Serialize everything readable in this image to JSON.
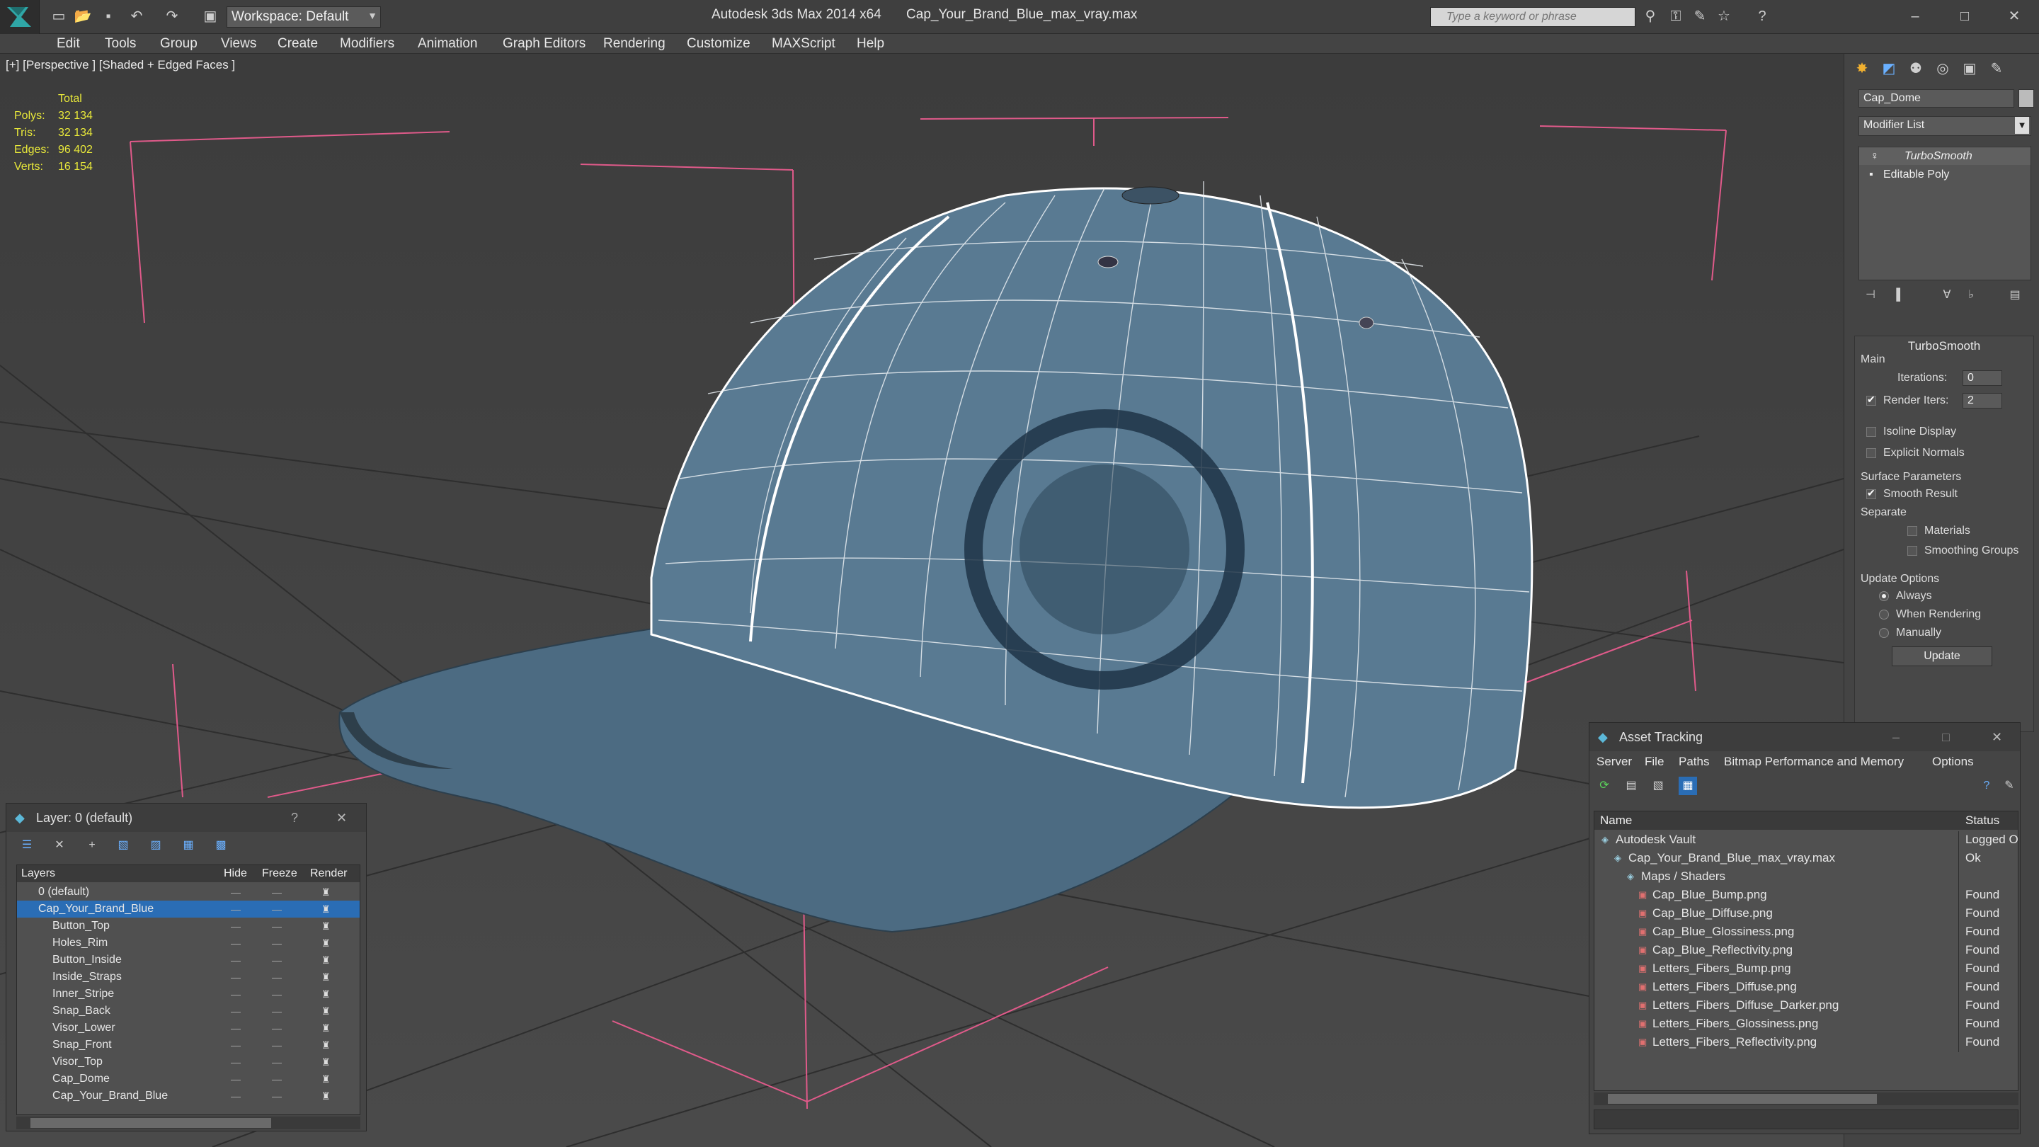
{
  "title": {
    "app": "Autodesk 3ds Max  2014 x64",
    "file": "Cap_Your_Brand_Blue_max_vray.max",
    "workspace": "Workspace: Default",
    "search_placeholder": "Type a keyword or phrase"
  },
  "menu": [
    "Edit",
    "Tools",
    "Group",
    "Views",
    "Create",
    "Modifiers",
    "Animation",
    "Graph Editors",
    "Rendering",
    "Customize",
    "MAXScript",
    "Help"
  ],
  "viewport": {
    "label": "[+] [Perspective ] [Shaded + Edged Faces ]",
    "stats": {
      "header": "Total",
      "rows": [
        {
          "label": "Polys:",
          "value": "32 134"
        },
        {
          "label": "Tris:",
          "value": "32 134"
        },
        {
          "label": "Edges:",
          "value": "96 402"
        },
        {
          "label": "Verts:",
          "value": "16 154"
        }
      ]
    }
  },
  "command_panel": {
    "object_name": "Cap_Dome",
    "modifier_list": "Modifier List",
    "stack": [
      "TurboSmooth",
      "Editable Poly"
    ],
    "rollout_title": "TurboSmooth",
    "main_label": "Main",
    "iterations_label": "Iterations:",
    "iterations_value": "0",
    "render_iters_label": "Render Iters:",
    "render_iters_value": "2",
    "isoline": "Isoline Display",
    "explicit_normals": "Explicit Normals",
    "surface_params": "Surface Parameters",
    "smooth_result": "Smooth Result",
    "separate": "Separate",
    "materials": "Materials",
    "smoothing_groups": "Smoothing Groups",
    "update_options": "Update Options",
    "always": "Always",
    "when_rendering": "When Rendering",
    "manually": "Manually",
    "update_button": "Update"
  },
  "layer_window": {
    "title": "Layer: 0 (default)",
    "help": "?",
    "columns": [
      "Layers",
      "Hide",
      "Freeze",
      "Render"
    ],
    "layers": [
      "0 (default)",
      "Cap_Your_Brand_Blue",
      "Button_Top",
      "Holes_Rim",
      "Button_Inside",
      "Inside_Straps",
      "Inner_Stripe",
      "Snap_Back",
      "Visor_Lower",
      "Snap_Front",
      "Visor_Top",
      "Cap_Dome",
      "Cap_Your_Brand_Blue"
    ]
  },
  "asset_window": {
    "title": "Asset Tracking",
    "menu": [
      "Server",
      "File",
      "Paths",
      "Bitmap Performance and Memory",
      "Options"
    ],
    "columns": [
      "Name",
      "Status"
    ],
    "rows": [
      {
        "name": "Autodesk Vault",
        "status": "Logged O"
      },
      {
        "name": "Cap_Your_Brand_Blue_max_vray.max",
        "status": "Ok"
      },
      {
        "name": "Maps / Shaders",
        "status": ""
      },
      {
        "name": "Cap_Blue_Bump.png",
        "status": "Found"
      },
      {
        "name": "Cap_Blue_Diffuse.png",
        "status": "Found"
      },
      {
        "name": "Cap_Blue_Glossiness.png",
        "status": "Found"
      },
      {
        "name": "Cap_Blue_Reflectivity.png",
        "status": "Found"
      },
      {
        "name": "Letters_Fibers_Bump.png",
        "status": "Found"
      },
      {
        "name": "Letters_Fibers_Diffuse.png",
        "status": "Found"
      },
      {
        "name": "Letters_Fibers_Diffuse_Darker.png",
        "status": "Found"
      },
      {
        "name": "Letters_Fibers_Glossiness.png",
        "status": "Found"
      },
      {
        "name": "Letters_Fibers_Reflectivity.png",
        "status": "Found"
      }
    ]
  },
  "colors": {
    "accent": "#2a6db5",
    "stats": "#e8e83a",
    "cap": "#4d6e86"
  }
}
